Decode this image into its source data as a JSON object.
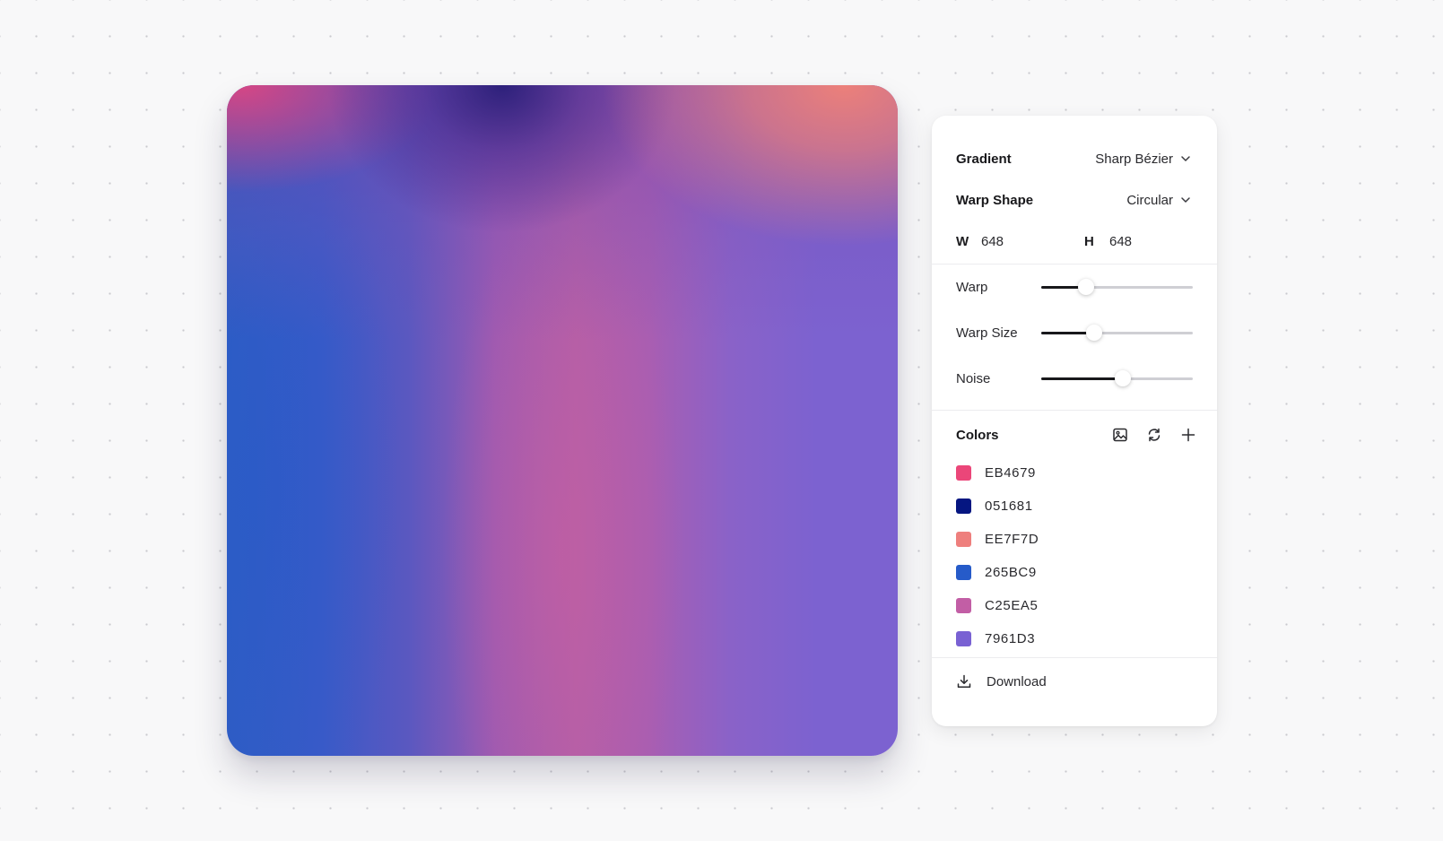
{
  "panel": {
    "gradient": {
      "label": "Gradient",
      "value": "Sharp Bézier"
    },
    "warp_shape": {
      "label": "Warp Shape",
      "value": "Circular"
    },
    "dimensions": {
      "w_label": "W",
      "w_value": "648",
      "h_label": "H",
      "h_value": "648"
    },
    "sliders": [
      {
        "label": "Warp",
        "value": 0.3
      },
      {
        "label": "Warp Size",
        "value": 0.35
      },
      {
        "label": "Noise",
        "value": 0.54
      }
    ],
    "colors": {
      "label": "Colors",
      "icons": [
        "image-icon",
        "refresh-icon",
        "plus-icon"
      ],
      "items": [
        {
          "hex": "EB4679",
          "color": "#EB4679"
        },
        {
          "hex": "051681",
          "color": "#051681"
        },
        {
          "hex": "EE7F7D",
          "color": "#EE7F7D"
        },
        {
          "hex": "265BC9",
          "color": "#265BC9"
        },
        {
          "hex": "C25EA5",
          "color": "#C25EA5"
        },
        {
          "hex": "7961D3",
          "color": "#7961D3"
        }
      ]
    },
    "download": {
      "label": "Download",
      "icon": "download-icon"
    }
  }
}
